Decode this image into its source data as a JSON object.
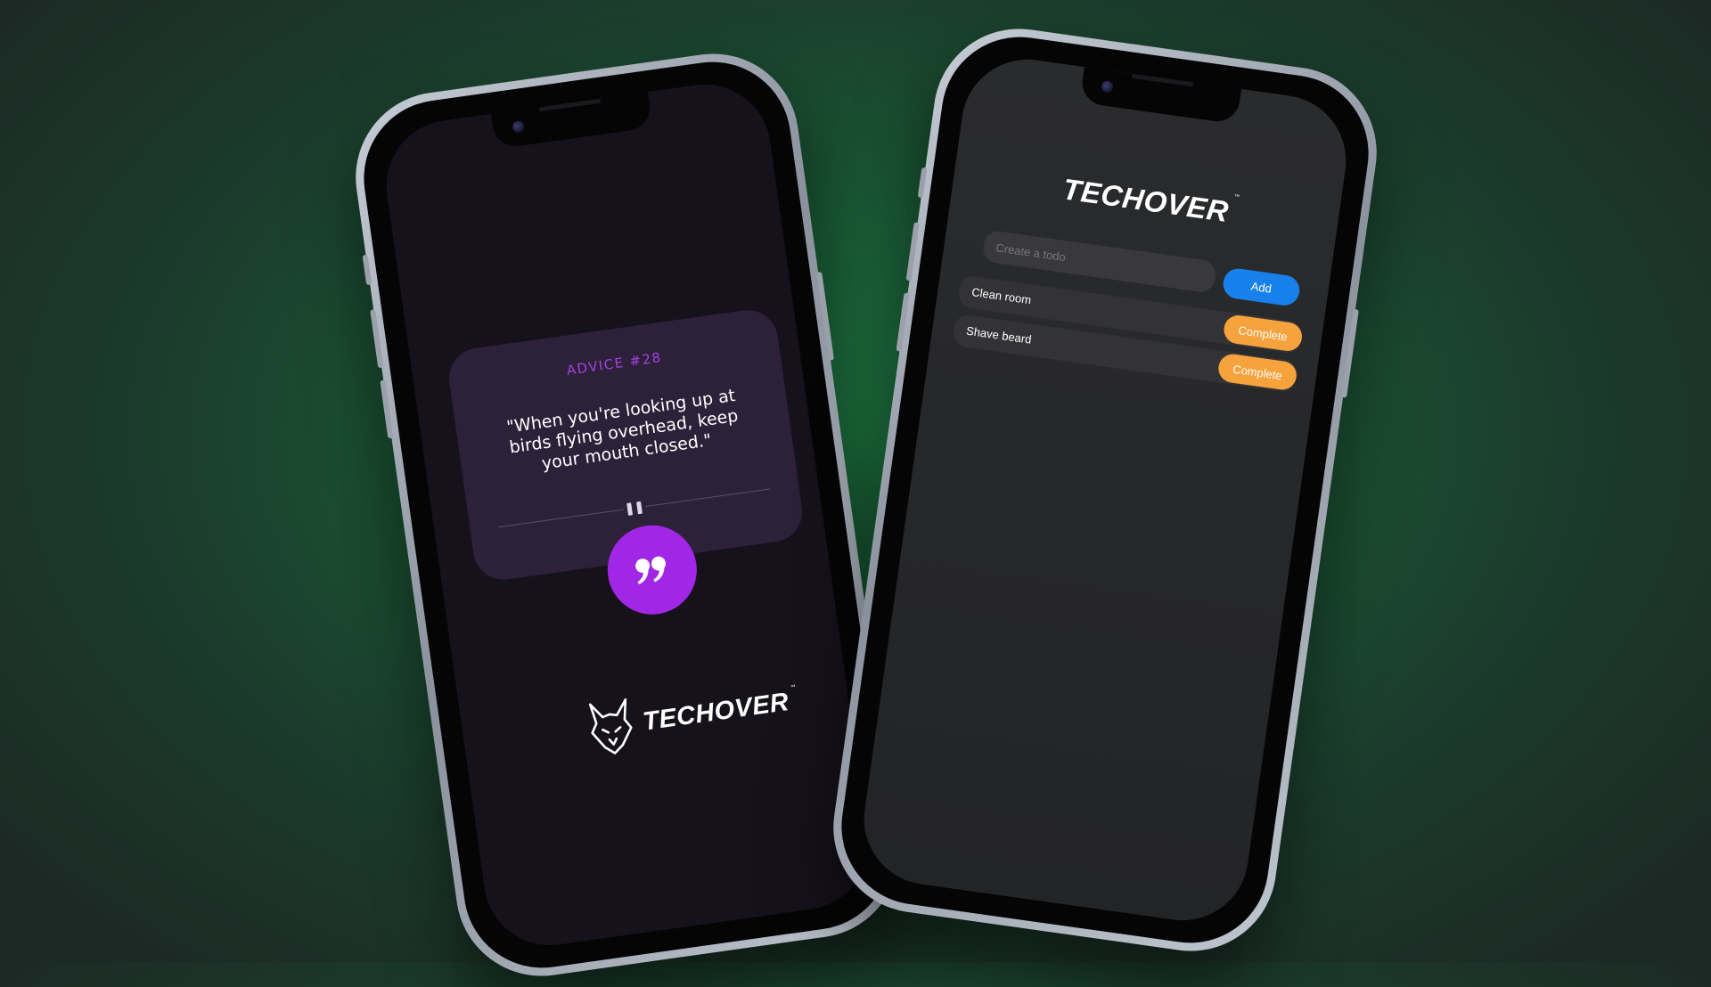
{
  "advice_app": {
    "title": "ADVICE #28",
    "advice_text": "\"When you're looking up at birds flying overhead, keep your mouth closed.\"",
    "brand": "TECHOVER",
    "trademark": "™",
    "colors": {
      "accent": "#a126e6",
      "card": "#2d2139",
      "background": "#16121c"
    }
  },
  "todo_app": {
    "brand": "TECHOVER",
    "trademark": "™",
    "input": {
      "placeholder": "Create a todo",
      "value": ""
    },
    "add_label": "Add",
    "items": [
      {
        "label": "Clean room",
        "action": "Complete"
      },
      {
        "label": "Shave beard",
        "action": "Complete"
      }
    ],
    "colors": {
      "add": "#1880ea",
      "complete": "#f6a23d",
      "background": "#2a2b2d"
    }
  },
  "icons": [
    "quote-icon",
    "pause-icon",
    "wolf-icon",
    "camera-icon"
  ]
}
